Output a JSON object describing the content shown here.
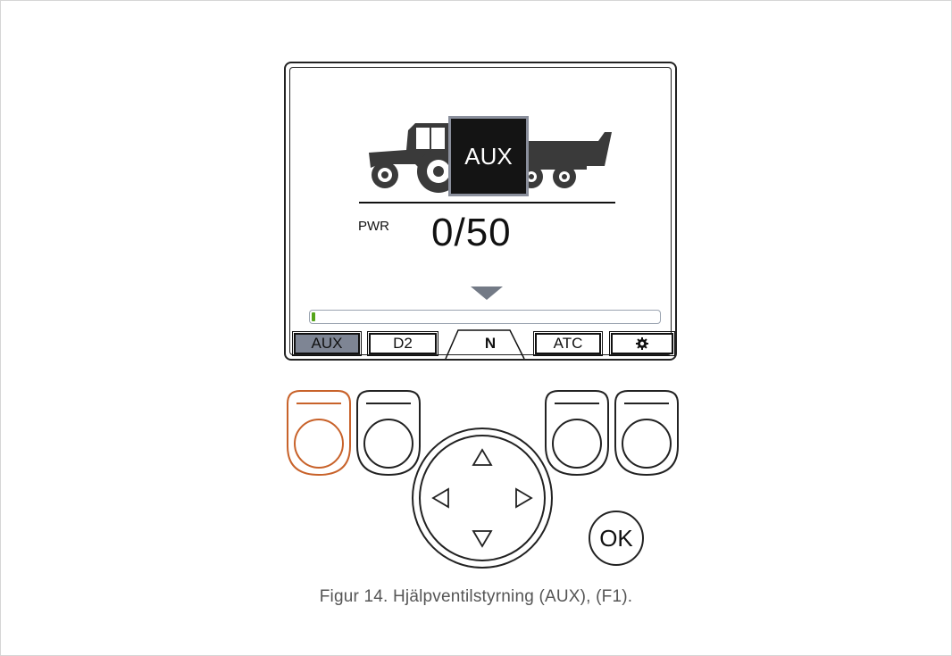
{
  "display": {
    "mode_block_label": "AUX",
    "pwr_label": "PWR",
    "pwr_value": "0/50",
    "progress_fraction": 0.01,
    "tabs": [
      {
        "label": "AUX",
        "active": true
      },
      {
        "label": "D2",
        "active": false
      },
      {
        "label": "N",
        "active": false
      },
      {
        "label": "ATC",
        "active": false
      },
      {
        "label": "gear-icon",
        "active": false
      }
    ]
  },
  "controls": {
    "ok_label": "OK",
    "highlight_color": "#c8622a"
  },
  "caption": "Figur 14. Hjälpventilstyrning (AUX), (F1)."
}
